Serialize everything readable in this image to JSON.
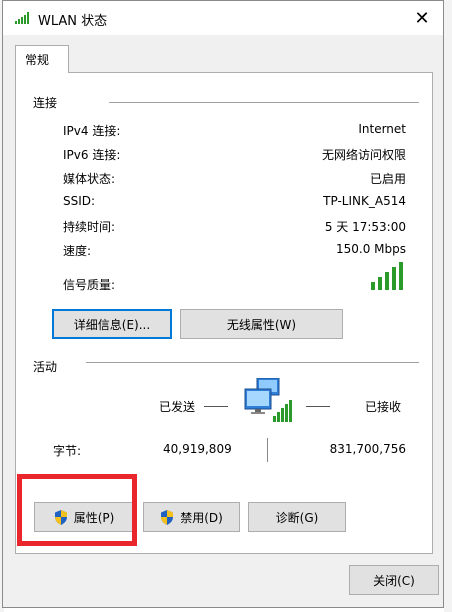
{
  "window": {
    "title": "WLAN 状态",
    "close_label": "✕"
  },
  "tabs": [
    {
      "label": "常规"
    }
  ],
  "connection": {
    "header": "连接",
    "rows": [
      {
        "label": "IPv4 连接:",
        "value": "Internet"
      },
      {
        "label": "IPv6 连接:",
        "value": "无网络访问权限"
      },
      {
        "label": "媒体状态:",
        "value": "已启用"
      },
      {
        "label": "SSID:",
        "value": "TP-LINK_A514"
      },
      {
        "label": "持续时间:",
        "value": "5 天 17:53:00"
      },
      {
        "label": "速度:",
        "value": "150.0 Mbps"
      }
    ],
    "signal_label": "信号质量:",
    "details_button": "详细信息(E)...",
    "wireless_props_button": "无线属性(W)"
  },
  "activity": {
    "header": "活动",
    "sent_label": "已发送",
    "received_label": "已接收",
    "bytes_label": "字节:",
    "bytes_sent": "40,919,809",
    "bytes_received": "831,700,756"
  },
  "buttons": {
    "properties": "属性(P)",
    "disable": "禁用(D)",
    "diagnose": "诊断(G)",
    "close": "关闭(C)"
  },
  "colors": {
    "highlight": "#e8262c",
    "accent": "#0078d7",
    "signal": "#2a9a2a"
  }
}
